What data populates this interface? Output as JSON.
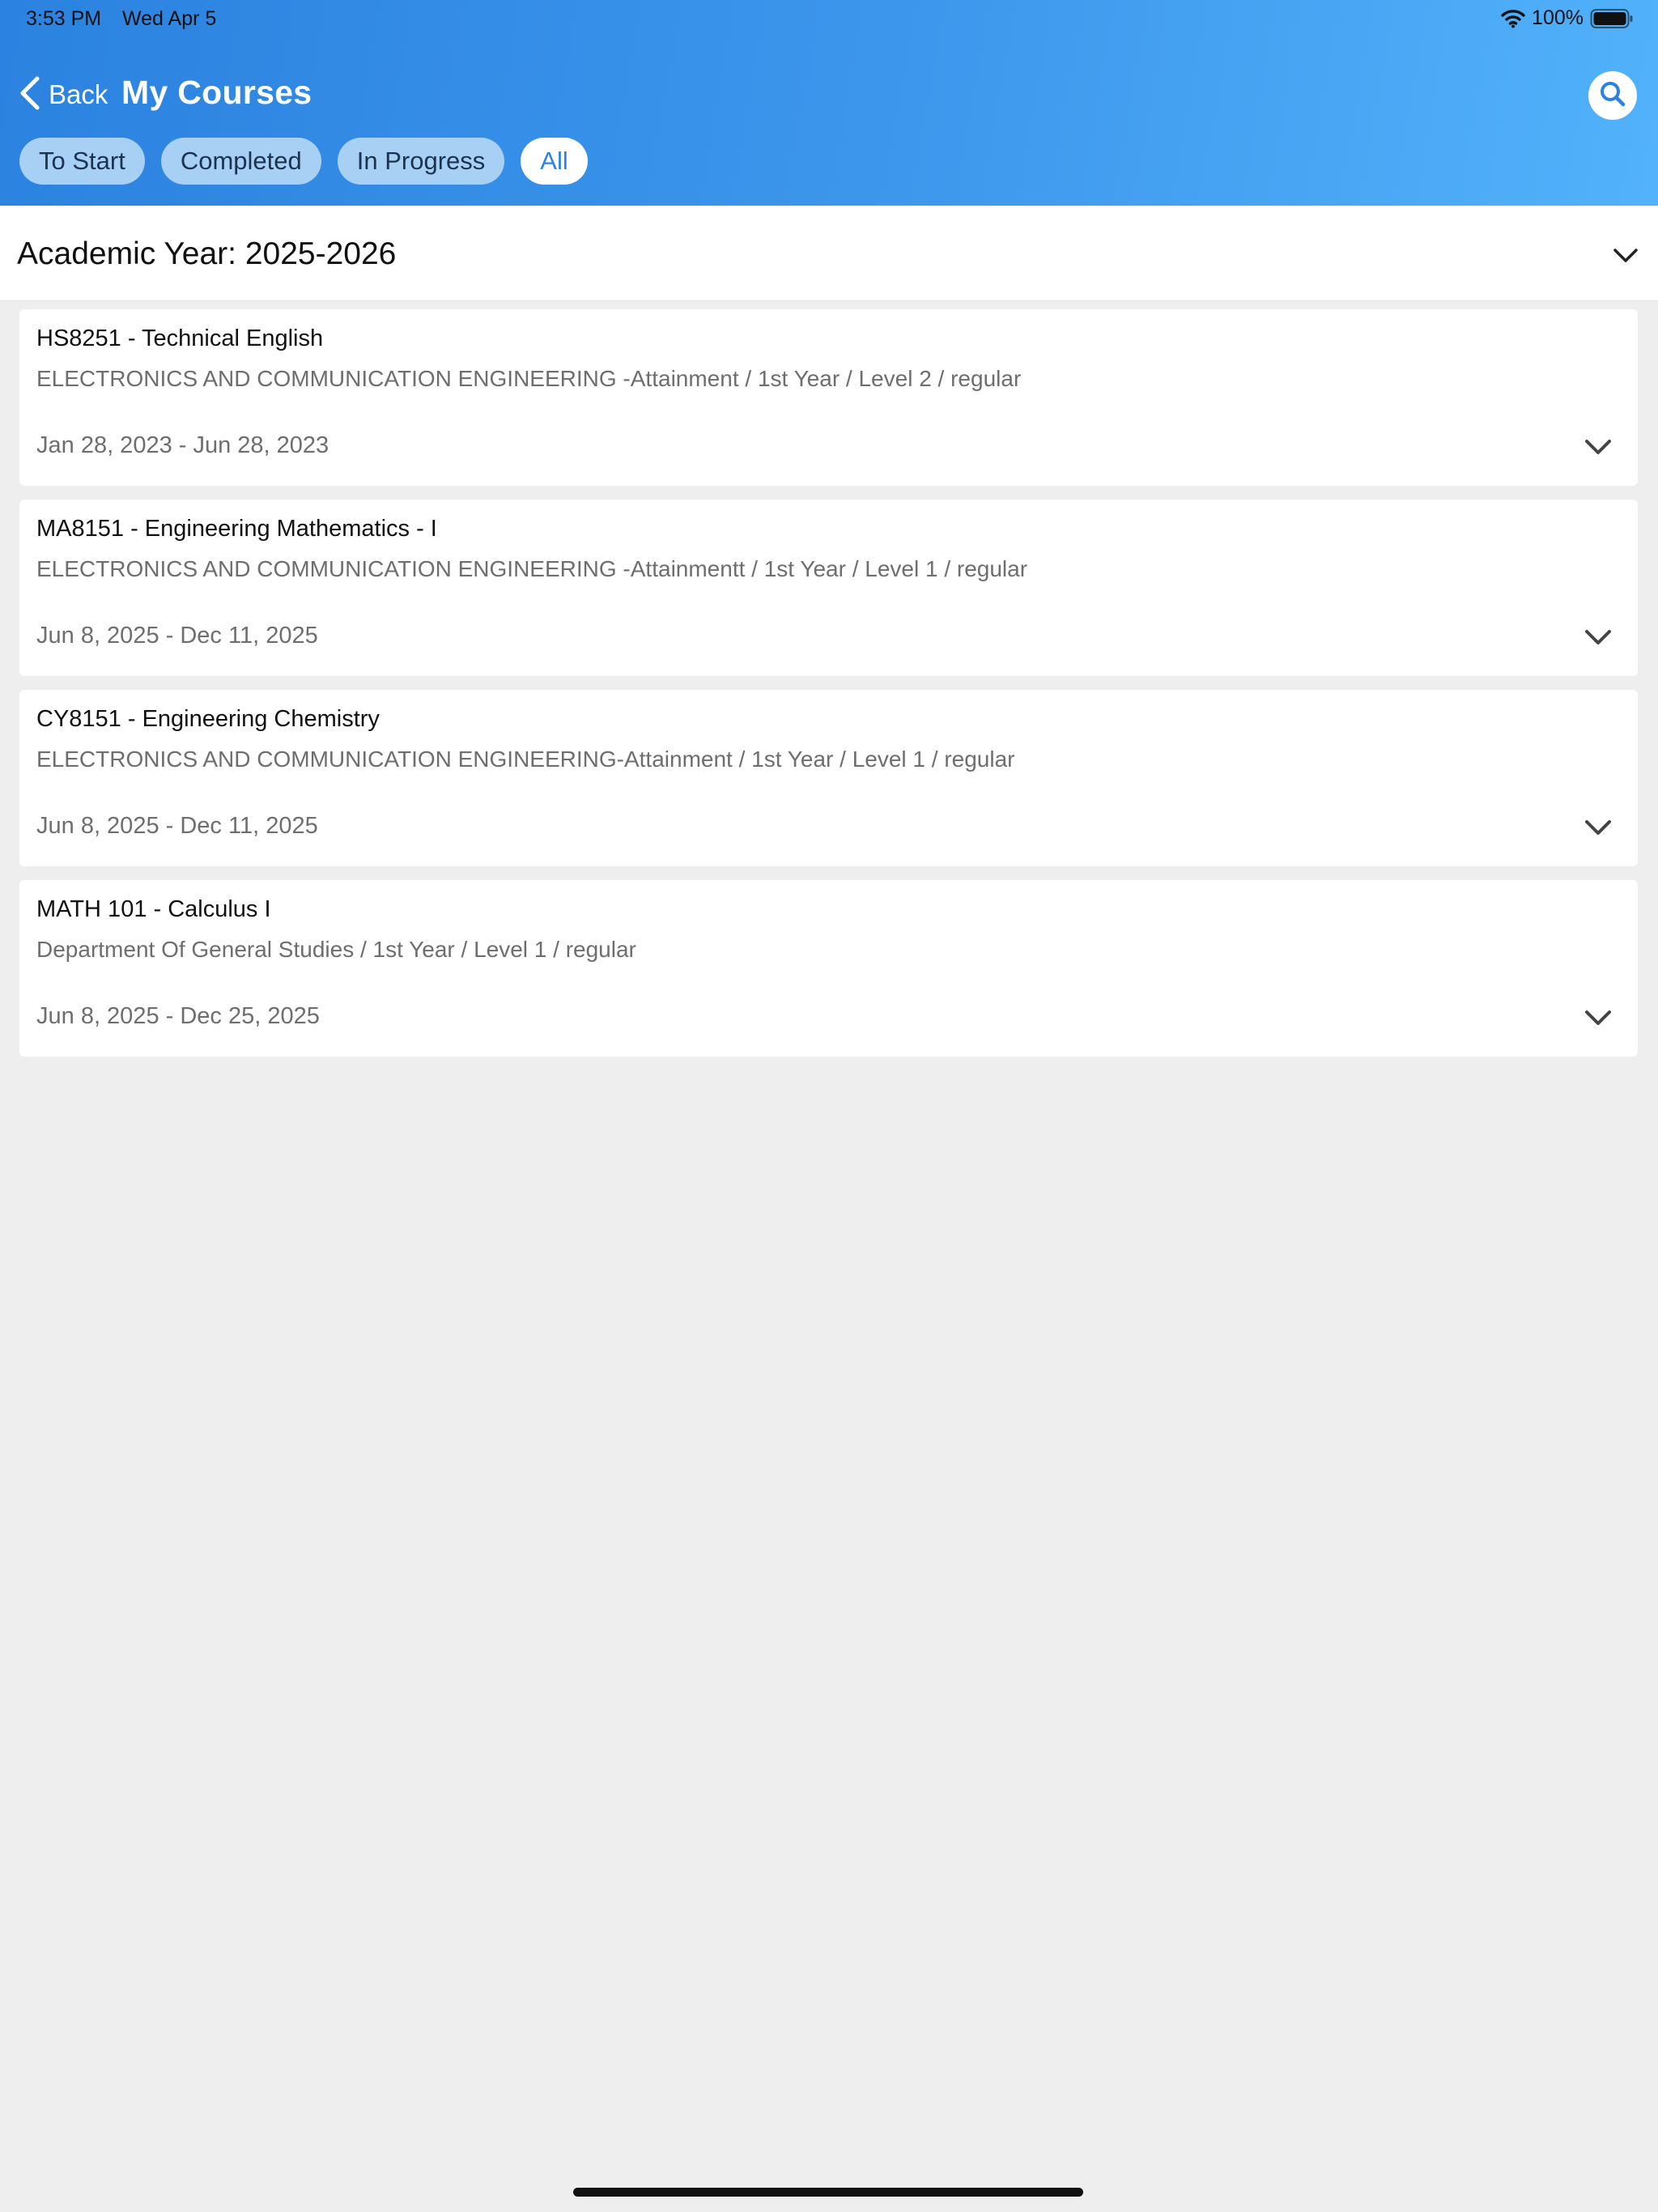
{
  "status_bar": {
    "time": "3:53 PM",
    "date": "Wed Apr 5",
    "battery": "100%"
  },
  "header": {
    "back_label": "Back",
    "title": "My Courses"
  },
  "filters": [
    "To Start",
    "Completed",
    "In Progress",
    "All"
  ],
  "active_filter": "All",
  "academic_year": "Academic Year: 2025-2026",
  "courses": [
    {
      "title": "HS8251 - Technical English",
      "department": "ELECTRONICS AND COMMUNICATION ENGINEERING -Attainment / 1st Year / Level 2 / regular",
      "dates": "Jan 28, 2023 - Jun 28, 2023"
    },
    {
      "title": "MA8151 - Engineering Mathematics - I",
      "department": "ELECTRONICS AND COMMUNICATION ENGINEERING -Attainmentt / 1st Year / Level 1 / regular",
      "dates": "Jun 8, 2025 - Dec 11, 2025"
    },
    {
      "title": "CY8151 - Engineering Chemistry",
      "department": "ELECTRONICS AND COMMUNICATION ENGINEERING-Attainment / 1st Year / Level 1 / regular",
      "dates": "Jun 8, 2025 - Dec 11, 2025"
    },
    {
      "title": "MATH 101 - Calculus I",
      "department": "Department Of General Studies / 1st Year / Level 1 / regular",
      "dates": "Jun 8, 2025 - Dec 25, 2025"
    }
  ],
  "icons": {
    "back": "chevron-left-icon",
    "search": "search-icon",
    "expand": "chevron-down-icon",
    "wifi": "wifi-icon",
    "battery": "battery-icon"
  },
  "colors": {
    "accent": "#2b82e0",
    "header_end": "#52b2fb",
    "chip_inactive": "#a8d0f4"
  }
}
